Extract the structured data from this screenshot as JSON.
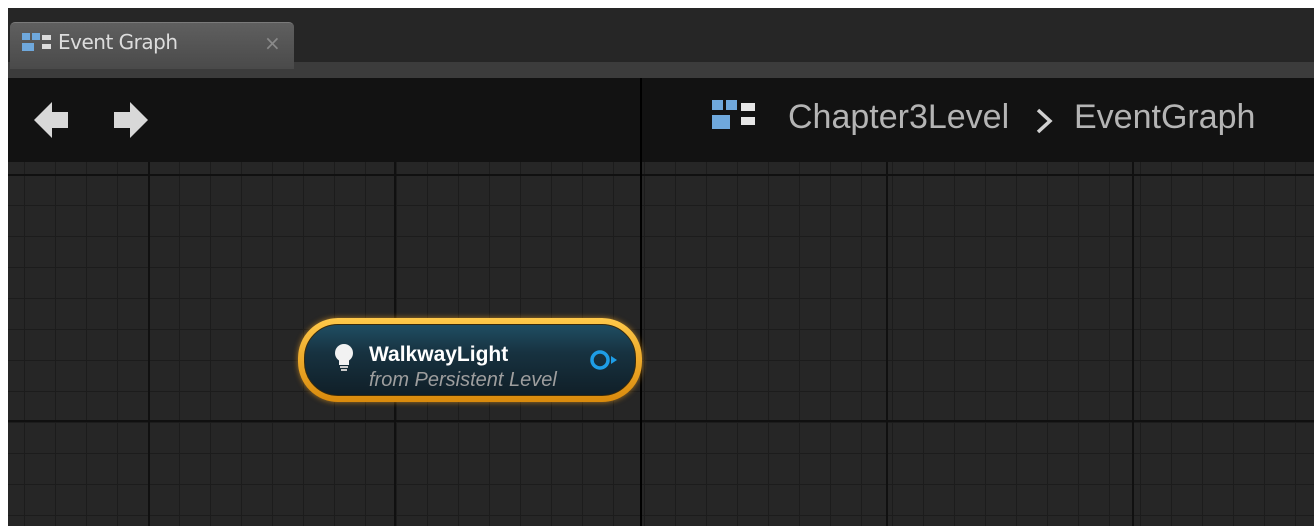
{
  "tab": {
    "label": "Event Graph",
    "icon": "event-graph-icon",
    "close_glyph": "×"
  },
  "toolbar": {
    "back_icon": "arrow-left-icon",
    "forward_icon": "arrow-right-icon",
    "breadcrumb": {
      "icon": "event-graph-icon",
      "items": [
        "Chapter3Level",
        "EventGraph"
      ],
      "separator_icon": "chevron-right-icon"
    }
  },
  "graph": {
    "node": {
      "title": "WalkwayLight",
      "subtitle": "from Persistent Level",
      "icon": "lightbulb-icon",
      "output_pin_icon": "object-pin-icon",
      "highlight_color": "#f0a824",
      "pin_color": "#1e9de6"
    }
  },
  "colors": {
    "graph_background": "#262626",
    "toolbar_background": "#121212",
    "tab_background": "#555555"
  }
}
